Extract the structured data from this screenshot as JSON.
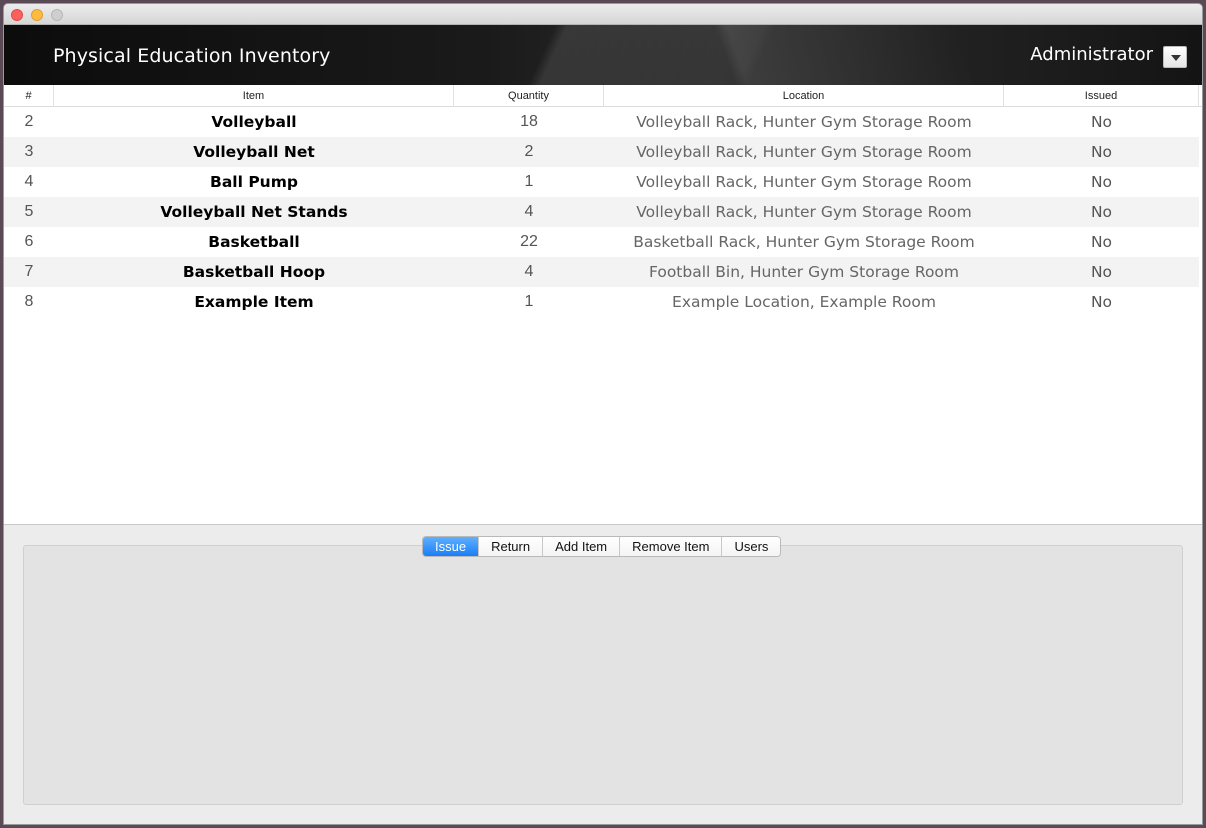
{
  "header": {
    "title": "Physical Education Inventory",
    "user": "Administrator"
  },
  "table": {
    "columns": [
      "#",
      "Item",
      "Quantity",
      "Location",
      "Issued"
    ],
    "rows": [
      {
        "num": "2",
        "item": "Volleyball",
        "quantity": "18",
        "location": "Volleyball Rack, Hunter Gym Storage Room",
        "issued": "No"
      },
      {
        "num": "3",
        "item": "Volleyball Net",
        "quantity": "2",
        "location": "Volleyball Rack, Hunter Gym Storage Room",
        "issued": "No"
      },
      {
        "num": "4",
        "item": "Ball Pump",
        "quantity": "1",
        "location": "Volleyball Rack, Hunter Gym Storage Room",
        "issued": "No"
      },
      {
        "num": "5",
        "item": "Volleyball Net Stands",
        "quantity": "4",
        "location": "Volleyball Rack, Hunter Gym Storage Room",
        "issued": "No"
      },
      {
        "num": "6",
        "item": "Basketball",
        "quantity": "22",
        "location": "Basketball Rack, Hunter Gym Storage Room",
        "issued": "No"
      },
      {
        "num": "7",
        "item": "Basketball Hoop",
        "quantity": "4",
        "location": "Football Bin, Hunter Gym Storage Room",
        "issued": "No"
      },
      {
        "num": "8",
        "item": "Example Item",
        "quantity": "1",
        "location": "Example Location, Example Room",
        "issued": "No"
      }
    ]
  },
  "tabs": {
    "items": [
      "Issue",
      "Return",
      "Add Item",
      "Remove Item",
      "Users"
    ],
    "selected": "Issue"
  },
  "colors": {
    "accent": "#1a7ef5",
    "header_bg": "#141414"
  }
}
